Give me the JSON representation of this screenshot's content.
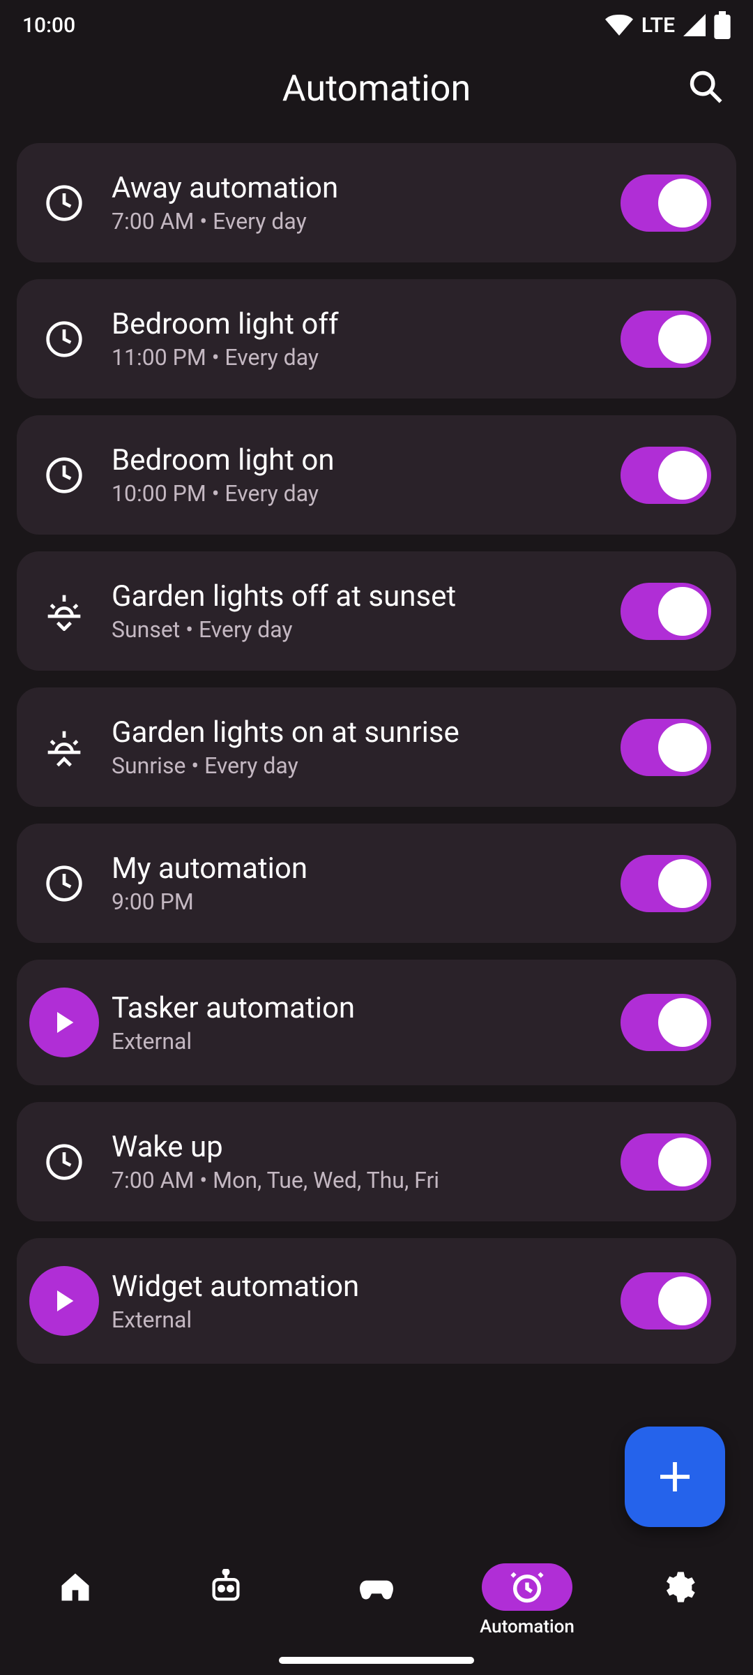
{
  "status": {
    "time": "10:00",
    "network": "LTE"
  },
  "header": {
    "title": "Automation"
  },
  "automations": [
    {
      "icon": "clock",
      "title": "Away automation",
      "subtitle": "7:00 AM • Every day",
      "enabled": true
    },
    {
      "icon": "clock",
      "title": "Bedroom light off",
      "subtitle": "11:00 PM • Every day",
      "enabled": true
    },
    {
      "icon": "clock",
      "title": "Bedroom light on",
      "subtitle": "10:00 PM • Every day",
      "enabled": true
    },
    {
      "icon": "sunset",
      "title": "Garden lights off at sunset",
      "subtitle": "Sunset • Every day",
      "enabled": true
    },
    {
      "icon": "sunrise",
      "title": "Garden lights on at sunrise",
      "subtitle": "Sunrise • Every day",
      "enabled": true
    },
    {
      "icon": "clock",
      "title": "My automation",
      "subtitle": "9:00 PM",
      "enabled": true
    },
    {
      "icon": "play",
      "title": "Tasker automation",
      "subtitle": "External",
      "enabled": true
    },
    {
      "icon": "clock",
      "title": "Wake up",
      "subtitle": "7:00 AM • Mon, Tue, Wed, Thu, Fri",
      "enabled": true
    },
    {
      "icon": "play",
      "title": "Widget automation",
      "subtitle": "External",
      "enabled": true
    }
  ],
  "nav": {
    "active": 3,
    "items": [
      {
        "icon": "home",
        "label": ""
      },
      {
        "icon": "robot",
        "label": ""
      },
      {
        "icon": "gamepad",
        "label": ""
      },
      {
        "icon": "alarm",
        "label": "Automation"
      },
      {
        "icon": "settings",
        "label": ""
      }
    ]
  }
}
